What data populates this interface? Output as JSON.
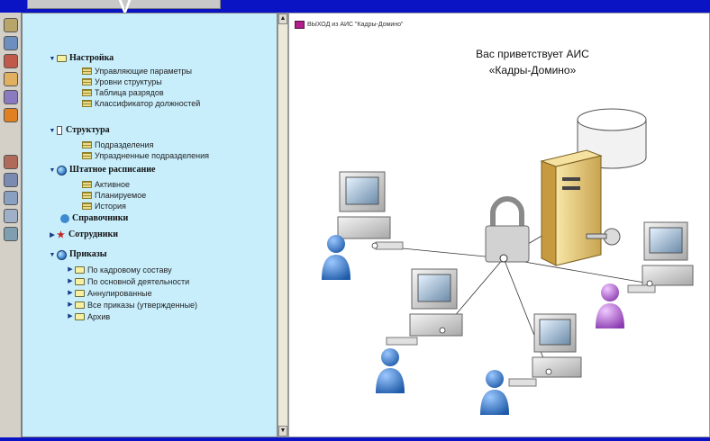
{
  "title_glyph": "у",
  "toolbar_icons": [
    {
      "name": "binoculars-icon",
      "color": "#b7a56a"
    },
    {
      "name": "staff-card-icon",
      "color": "#6c8fbf"
    },
    {
      "name": "folder-card-icon",
      "color": "#c05a4a"
    },
    {
      "name": "document-icon",
      "color": "#e0b060"
    },
    {
      "name": "org-icon",
      "color": "#8a7ac0"
    },
    {
      "name": "globe-icon",
      "color": "#e08020"
    },
    {
      "name": "people-icon",
      "color": "#b06a5a"
    },
    {
      "name": "settings-people-icon",
      "color": "#7a8ab0"
    },
    {
      "name": "search-people-icon",
      "color": "#8aa0c0"
    },
    {
      "name": "chart-people-icon",
      "color": "#a0b0c8"
    },
    {
      "name": "report-icon",
      "color": "#7f9fb0"
    }
  ],
  "tree": {
    "settings": {
      "label": "Настройка",
      "items": [
        "Управляющие параметры",
        "Уровни структуры",
        "Таблица разрядов",
        "Классификатор должностей"
      ]
    },
    "structure": {
      "label": "Структура",
      "items": [
        "Подразделения",
        "Упраздненные подразделения"
      ]
    },
    "staffing": {
      "label": "Штатное расписание",
      "items": [
        "Активное",
        "Планируемое",
        "История"
      ]
    },
    "references": {
      "label": "Справочники"
    },
    "employees": {
      "label": "Сотрудники"
    },
    "orders": {
      "label": "Приказы",
      "items": [
        "По кадровому составу",
        "По основной деятельности",
        "Аннулированные",
        "Все приказы (утвержденные)",
        "Архив"
      ]
    }
  },
  "main": {
    "mini_title": "ВЫХОД из АИС \"Кадры-Домино\"",
    "welcome_line1": "Вас приветствует АИС",
    "welcome_line2": "«Кадры-Домино»"
  }
}
